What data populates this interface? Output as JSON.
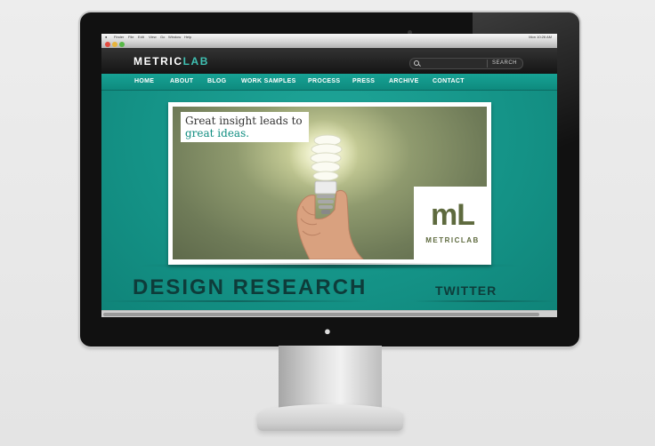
{
  "menubar": {
    "apple": "",
    "items": [
      "Finder",
      "File",
      "Edit",
      "View",
      "Go",
      "Window",
      "Help"
    ],
    "clock": "Mon 10:26 AM"
  },
  "site": {
    "logo_metric": "METRIC",
    "logo_lab": "LAB",
    "search_placeholder": "",
    "search_button": "SEARCH"
  },
  "nav": {
    "items": [
      {
        "label": "HOME"
      },
      {
        "label": "ABOUT"
      },
      {
        "label": "BLOG"
      },
      {
        "label": "WORK SAMPLES"
      },
      {
        "label": "PROCESS"
      },
      {
        "label": "PRESS"
      },
      {
        "label": "ARCHIVE"
      },
      {
        "label": "CONTACT"
      }
    ]
  },
  "hero": {
    "tagline_1": "Great insight leads to",
    "tagline_2": "great ideas.",
    "badge_mark": "mL",
    "badge_name": "METRICLAB"
  },
  "sections": {
    "design_research": "DESIGN RESEARCH",
    "twitter": "TWITTER"
  },
  "colors": {
    "teal": "#16968b",
    "brand_green": "#5e6a3e",
    "heading_dark": "#0e3c3a"
  }
}
